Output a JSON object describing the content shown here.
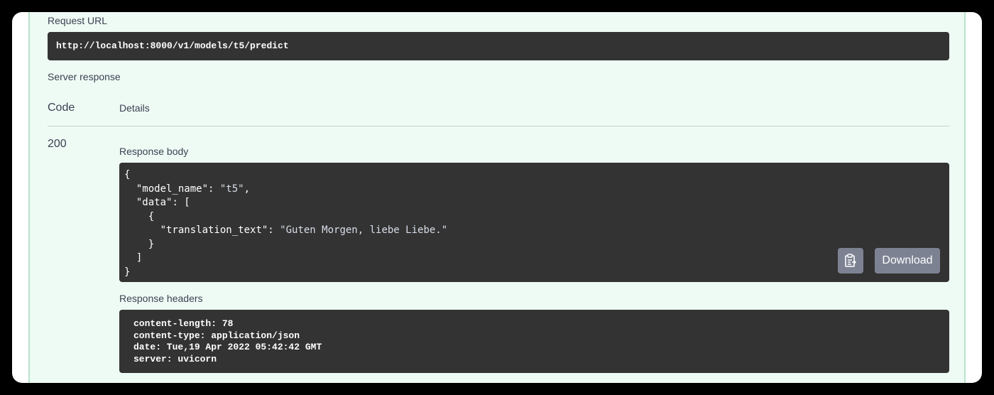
{
  "request_url": {
    "label": "Request URL",
    "value": "http://localhost:8000/v1/models/t5/predict"
  },
  "server_response": {
    "label": "Server response",
    "columns": {
      "code": "Code",
      "details": "Details"
    },
    "status_code": "200",
    "response_body": {
      "label": "Response body",
      "lines": [
        {
          "indent": "",
          "parts": [
            {
              "t": "{",
              "c": "p"
            }
          ]
        },
        {
          "indent": "  ",
          "parts": [
            {
              "t": "\"model_name\"",
              "c": "k"
            },
            {
              "t": ": ",
              "c": "p"
            },
            {
              "t": "\"t5\"",
              "c": "s"
            },
            {
              "t": ",",
              "c": "p"
            }
          ]
        },
        {
          "indent": "  ",
          "parts": [
            {
              "t": "\"data\"",
              "c": "k"
            },
            {
              "t": ": [",
              "c": "p"
            }
          ]
        },
        {
          "indent": "    ",
          "parts": [
            {
              "t": "{",
              "c": "p"
            }
          ]
        },
        {
          "indent": "      ",
          "parts": [
            {
              "t": "\"translation_text\"",
              "c": "k"
            },
            {
              "t": ": ",
              "c": "p"
            },
            {
              "t": "\"Guten Morgen, liebe Liebe.\"",
              "c": "s"
            }
          ]
        },
        {
          "indent": "    ",
          "parts": [
            {
              "t": "}",
              "c": "p"
            }
          ]
        },
        {
          "indent": "  ",
          "parts": [
            {
              "t": "]",
              "c": "p"
            }
          ]
        },
        {
          "indent": "",
          "parts": [
            {
              "t": "}",
              "c": "p"
            }
          ]
        }
      ],
      "copy_icon": "clipboard-icon",
      "download_label": "Download"
    },
    "response_headers": {
      "label": "Response headers",
      "lines": [
        "content-length: 78",
        "content-type: application/json",
        "date: Tue,19 Apr 2022 05:42:42 GMT",
        "server: uvicorn"
      ]
    }
  },
  "colors": {
    "panel_background": "#eefbf5",
    "panel_border": "#b7e4cc",
    "code_background": "#333333",
    "button_background": "#7d8293",
    "json_string": "#a2fca2"
  }
}
